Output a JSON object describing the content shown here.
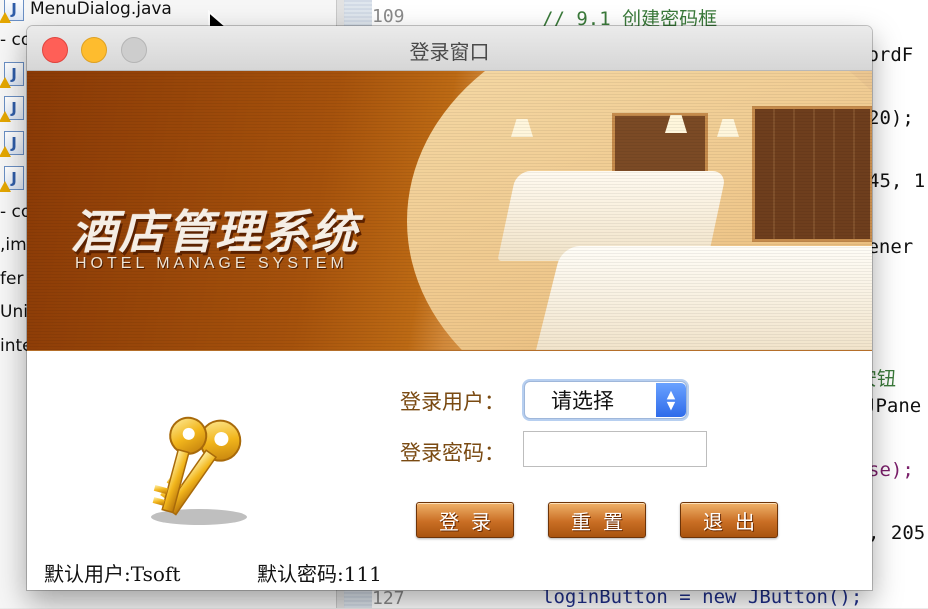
{
  "ide": {
    "tree": [
      {
        "text": "MenuDialog.java",
        "icon": "java-file-icon"
      },
      {
        "text": "- co",
        "icon": ""
      },
      {
        "text": "",
        "icon": "java-file-icon"
      },
      {
        "text": "",
        "icon": "java-file-icon"
      },
      {
        "text": "",
        "icon": "java-file-icon"
      },
      {
        "text": "",
        "icon": "java-file-icon"
      },
      {
        "text": "- co",
        "icon": ""
      },
      {
        "text": ",im",
        "icon": ""
      },
      {
        "text": "fer",
        "icon": ""
      },
      {
        "text": "Unit",
        "icon": ""
      },
      {
        "text": "inte",
        "icon": ""
      }
    ],
    "line_numbers": [
      "109",
      "127"
    ],
    "code_lines": [
      "// 9.1 创建密码框",
      "wordF",
      "20);",
      "45, 1",
      "tener",
      "安钮",
      "JPane",
      "se);",
      ", 205",
      "loginButton = new JButton();"
    ]
  },
  "dialog": {
    "title": "登录窗口",
    "banner": {
      "title": "酒店管理系统",
      "subtitle": "HOTEL MANAGE SYSTEM"
    },
    "form": {
      "user_label": "登录用户：",
      "user_select_value": "请选择",
      "password_label": "登录密码：",
      "password_value": "",
      "login_button": "登录",
      "reset_button": "重置",
      "exit_button": "退出",
      "hint_user": "默认用户:Tsoft",
      "hint_password": "默认密码:111"
    },
    "colors": {
      "label": "#7a4a12",
      "button": "#c96e24",
      "close_light": "#ff5f57",
      "minimize_light": "#febc2e",
      "zoom_light": "#c8c8c8"
    }
  }
}
